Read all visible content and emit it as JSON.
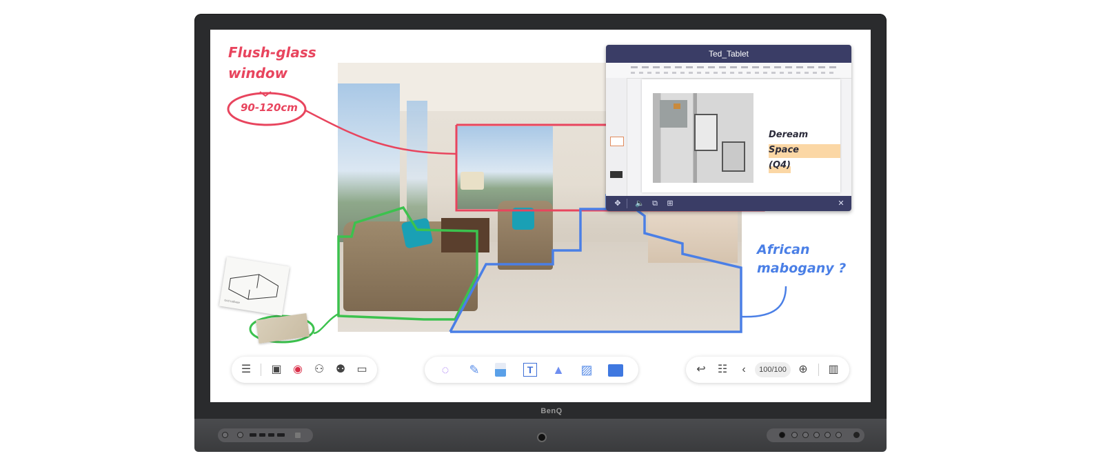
{
  "device": {
    "brand": "BenQ"
  },
  "annotations": {
    "flush_glass_line1": "Flush-glass",
    "flush_glass_line2": "window",
    "size": "90-120cm",
    "mahogany_line1": "African",
    "mahogany_line2": "mabogany ?",
    "sketch_caption": "Grid Ltdbase"
  },
  "tablet_window": {
    "title": "Ted_Tablet",
    "slide_title_line1": "Deream Space",
    "slide_title_line2": "(Q4)"
  },
  "toolbar_left": {
    "icons": [
      "menu-icon",
      "save-icon",
      "record-icon",
      "add-user-icon",
      "share-user-icon",
      "chat-icon"
    ]
  },
  "toolbar_center": {
    "icons": [
      "lasso-select-icon",
      "pen-icon",
      "eraser-icon",
      "text-icon",
      "shapes-icon",
      "image-icon",
      "toolbox-icon"
    ]
  },
  "toolbar_right": {
    "page_count": "100/100",
    "icons": [
      "undo-icon",
      "page-settings-icon",
      "previous-page-icon",
      "add-page-icon",
      "page-overview-icon"
    ]
  },
  "colors": {
    "annotation_red": "#e8455e",
    "annotation_blue": "#4a7fe6",
    "annotation_green": "#3cc24e",
    "tablet_header": "#3a3d66",
    "bezel": "#2a2b2d"
  }
}
